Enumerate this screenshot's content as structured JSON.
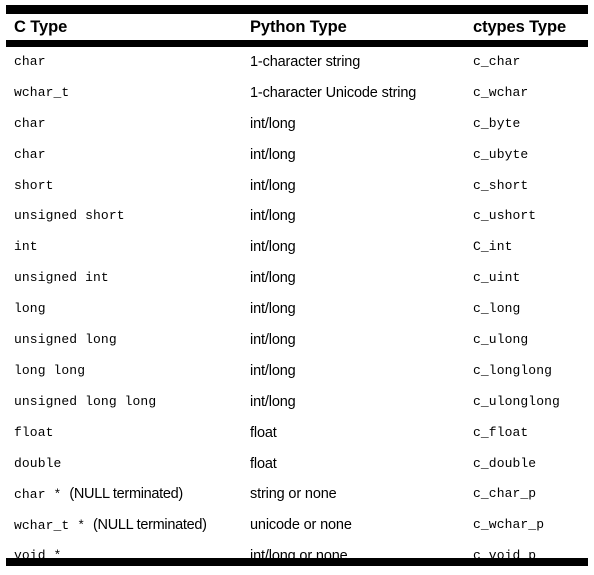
{
  "table": {
    "columns": [
      {
        "key": "c_type",
        "label": "C Type"
      },
      {
        "key": "python_type",
        "label": "Python Type"
      },
      {
        "key": "ctypes_type",
        "label": "ctypes Type"
      }
    ],
    "rows": [
      {
        "c_type": "char",
        "c_type_mono": "char",
        "c_type_annot": "",
        "python_type": "1-character string",
        "ctypes_type": "c_char"
      },
      {
        "c_type": "wchar_t",
        "c_type_mono": "wchar_t",
        "c_type_annot": "",
        "python_type": "1-character Unicode string",
        "ctypes_type": "c_wchar"
      },
      {
        "c_type": "char",
        "c_type_mono": "char",
        "c_type_annot": "",
        "python_type": "int/long",
        "ctypes_type": "c_byte"
      },
      {
        "c_type": "char",
        "c_type_mono": "char",
        "c_type_annot": "",
        "python_type": "int/long",
        "ctypes_type": "c_ubyte"
      },
      {
        "c_type": "short",
        "c_type_mono": "short",
        "c_type_annot": "",
        "python_type": "int/long",
        "ctypes_type": "c_short"
      },
      {
        "c_type": "unsigned short",
        "c_type_mono": "unsigned short",
        "c_type_annot": "",
        "python_type": "int/long",
        "ctypes_type": "c_ushort"
      },
      {
        "c_type": "int",
        "c_type_mono": "int",
        "c_type_annot": "",
        "python_type": "int/long",
        "ctypes_type": "C_int"
      },
      {
        "c_type": "unsigned int",
        "c_type_mono": "unsigned int",
        "c_type_annot": "",
        "python_type": "int/long",
        "ctypes_type": "c_uint"
      },
      {
        "c_type": "long",
        "c_type_mono": "long",
        "c_type_annot": "",
        "python_type": "int/long",
        "ctypes_type": "c_long"
      },
      {
        "c_type": "unsigned long",
        "c_type_mono": "unsigned long",
        "c_type_annot": "",
        "python_type": "int/long",
        "ctypes_type": "c_ulong"
      },
      {
        "c_type": "long long",
        "c_type_mono": "long long",
        "c_type_annot": "",
        "python_type": "int/long",
        "ctypes_type": "c_longlong"
      },
      {
        "c_type": "unsigned long long",
        "c_type_mono": "unsigned long long",
        "c_type_annot": "",
        "python_type": "int/long",
        "ctypes_type": "c_ulonglong"
      },
      {
        "c_type": "float",
        "c_type_mono": "float",
        "c_type_annot": "",
        "python_type": "float",
        "ctypes_type": "c_float"
      },
      {
        "c_type": "double",
        "c_type_mono": "double",
        "c_type_annot": "",
        "python_type": "float",
        "ctypes_type": "c_double"
      },
      {
        "c_type": "char * (NULL terminated)",
        "c_type_mono": "char *",
        "c_type_annot": "(NULL terminated)",
        "python_type": "string or none",
        "ctypes_type": "c_char_p"
      },
      {
        "c_type": "wchar_t * (NULL terminated)",
        "c_type_mono": "wchar_t *",
        "c_type_annot": "(NULL terminated)",
        "python_type": "unicode or none",
        "ctypes_type": "c_wchar_p"
      },
      {
        "c_type": "void *",
        "c_type_mono": "void *",
        "c_type_annot": "",
        "python_type": "int/long or none",
        "ctypes_type": "c_void_p"
      }
    ]
  },
  "colors": {
    "background": "#ffffff",
    "text": "#000000",
    "rule": "#000000"
  }
}
